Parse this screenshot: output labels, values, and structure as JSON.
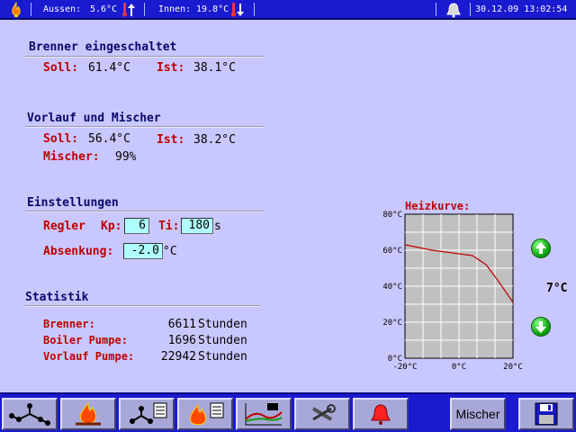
{
  "topbar": {
    "outside_label": "Aussen:",
    "outside_value": "5.6°C",
    "inside_label": "Innen:",
    "inside_value": "19.8°C",
    "datetime": "30.12.09 13:02:54"
  },
  "burner": {
    "heading": "Brenner eingeschaltet",
    "soll_label": "Soll:",
    "soll_value": "61.4°C",
    "ist_label": "Ist:",
    "ist_value": "38.1°C"
  },
  "flow": {
    "heading": "Vorlauf und Mischer",
    "soll_label": "Soll:",
    "soll_value": "56.4°C",
    "ist_label": "Ist:",
    "ist_value": "38.2°C",
    "mixer_label": "Mischer:",
    "mixer_value": "99%"
  },
  "settings": {
    "heading": "Einstellungen",
    "regler_label": "Regler",
    "kp_label": "Kp:",
    "kp_value": "6",
    "ti_label": "Ti:",
    "ti_value": "180",
    "ti_unit": "s",
    "absenkung_label": "Absenkung:",
    "absenkung_value": "-2.0",
    "absenkung_unit": "°C"
  },
  "stats": {
    "heading": "Statistik",
    "rows": [
      {
        "label": "Brenner:",
        "value": "6611",
        "unit": "Stunden"
      },
      {
        "label": "Boiler Pumpe:",
        "value": "1696",
        "unit": "Stunden"
      },
      {
        "label": "Vorlauf Pumpe:",
        "value": "22942",
        "unit": "Stunden"
      }
    ]
  },
  "heizkurve": {
    "title": "Heizkurve:",
    "offset_value": "7°C"
  },
  "chart_data": {
    "type": "line",
    "title": "Heizkurve:",
    "x": [
      -20,
      -15,
      -10,
      -5,
      0,
      5,
      10,
      15,
      20
    ],
    "series": [
      {
        "values": [
          63,
          61.5,
          60,
          59,
          58,
          57,
          52,
          42,
          31
        ]
      }
    ],
    "xlim": [
      -20,
      20
    ],
    "ylim": [
      0,
      80
    ],
    "x_ticks": [
      "-20°C",
      "0°C",
      "20°C"
    ],
    "y_ticks": [
      "0°C",
      "20°C",
      "40°C",
      "60°C",
      "80°C"
    ],
    "grid": true,
    "line_color": "#c00000"
  },
  "toolbar": {
    "mischer_label": "Mischer"
  },
  "colors": {
    "background": "#c8c8ff",
    "bar": "#1a1ad0",
    "heading": "#08086a",
    "label": "#c00000",
    "input_bg": "#b0ffff"
  }
}
